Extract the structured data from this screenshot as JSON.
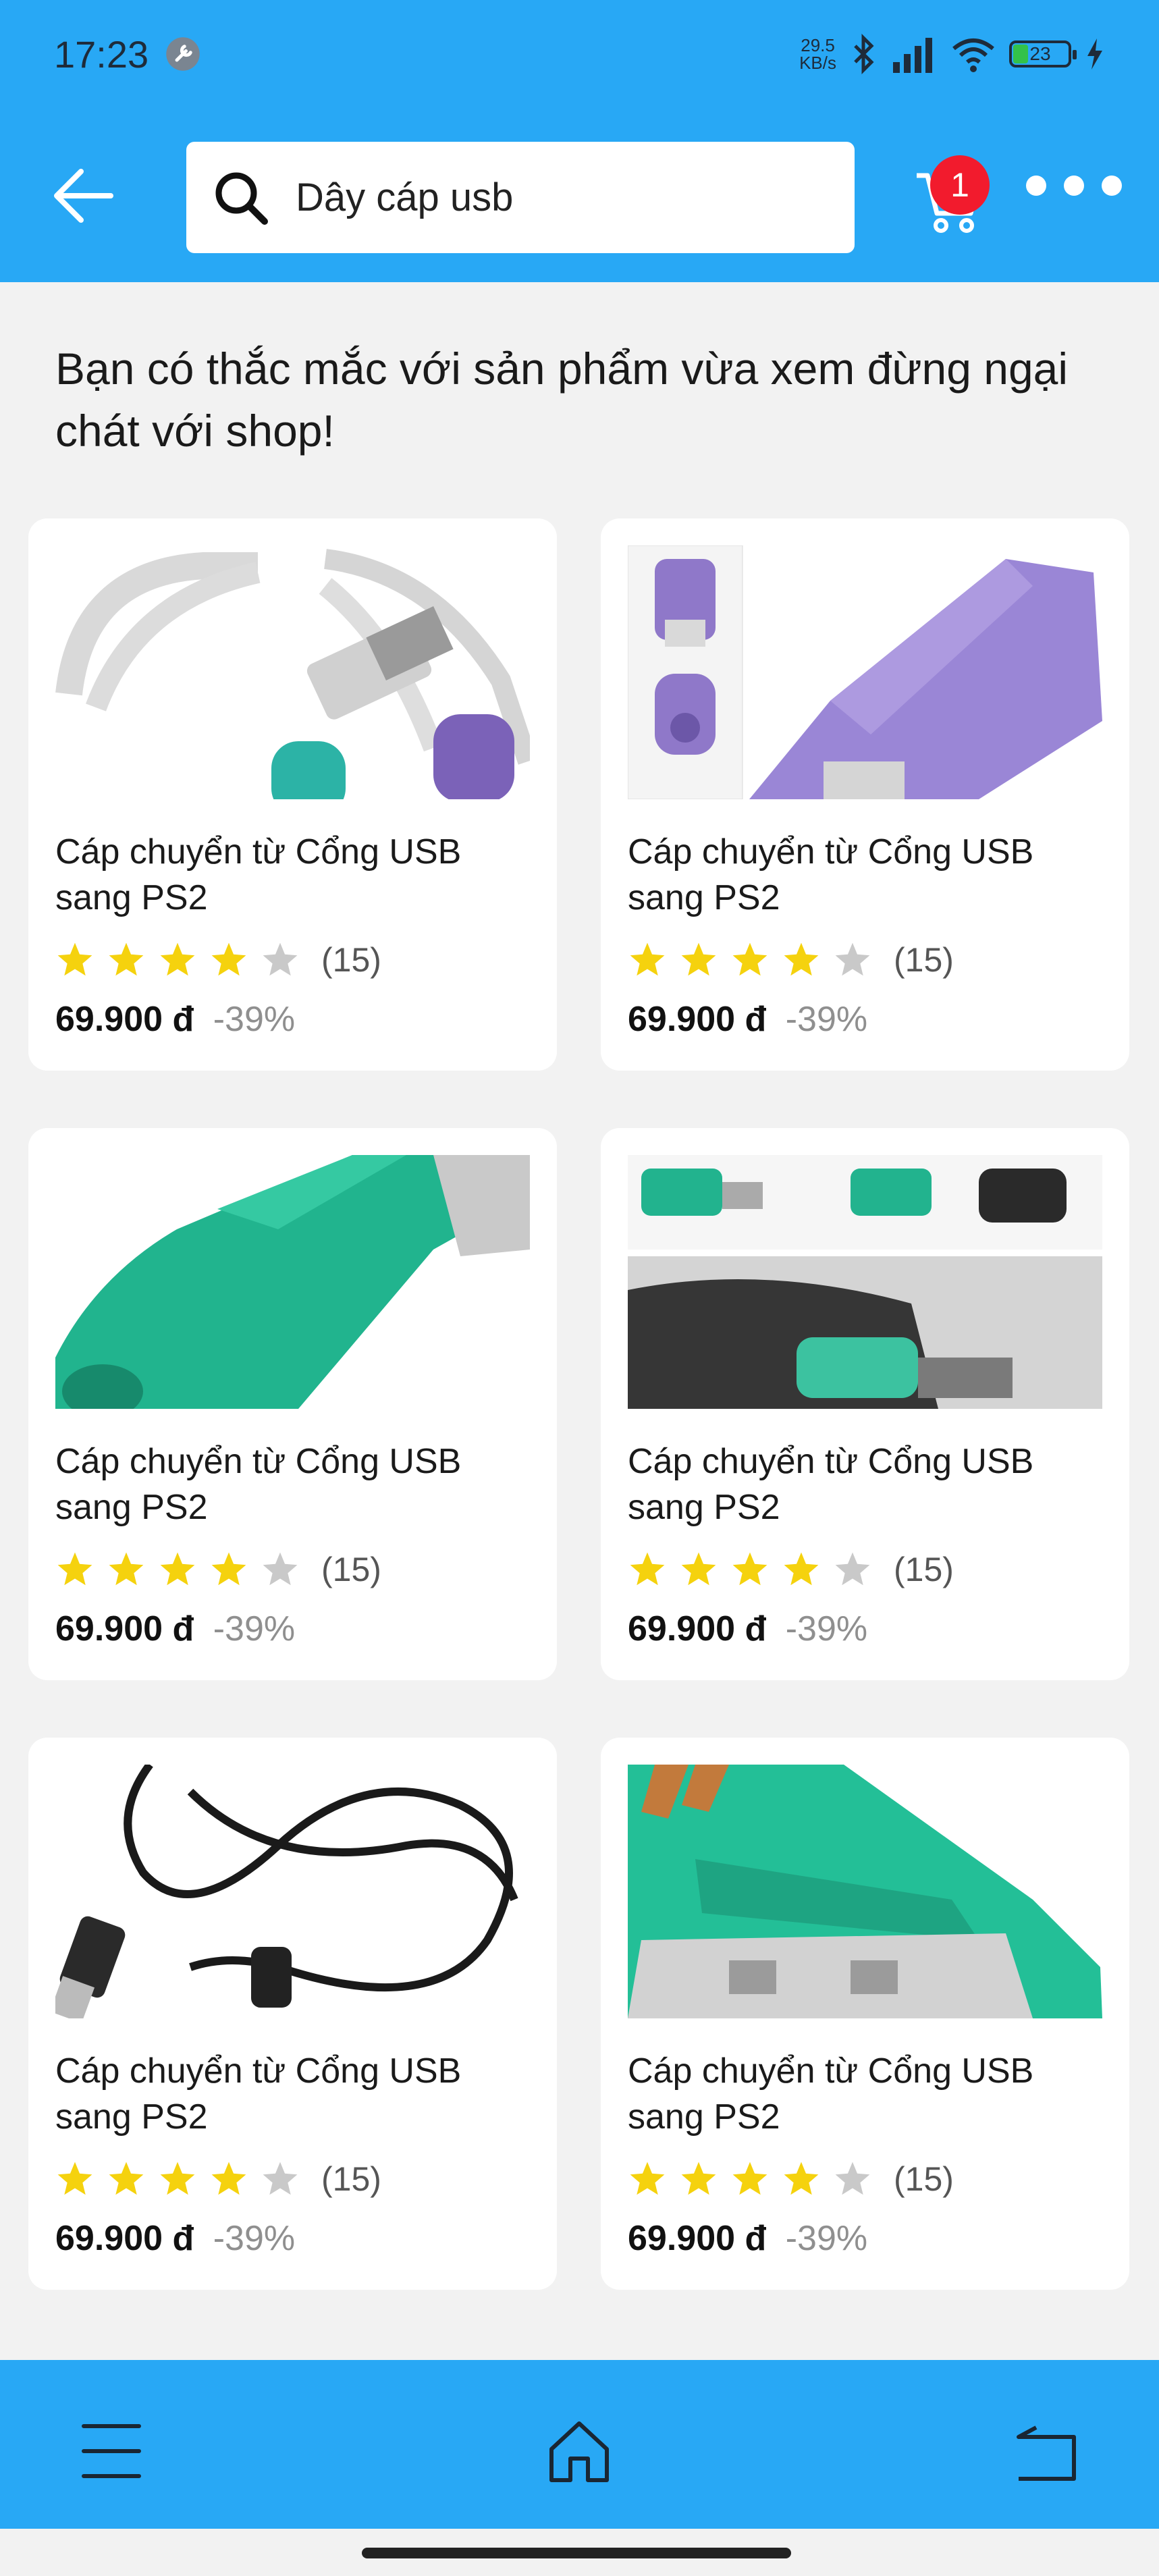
{
  "status": {
    "time": "17:23",
    "net_speed_value": "29.5",
    "net_speed_unit": "KB/s",
    "battery": "23"
  },
  "header": {
    "search_value": "Dây cáp usb",
    "cart_count": "1"
  },
  "notice": "Bạn có thắc mắc với sản phẩm vừa xem đừng ngại chát với shop!",
  "products": [
    {
      "title": "Cáp chuyển từ Cổng USB sang PS2",
      "rating": 4,
      "reviews": "(15)",
      "price": "69.900 đ",
      "discount": "-39%",
      "image": "usb-ps2-y-cable"
    },
    {
      "title": "Cáp chuyển từ Cổng USB sang PS2",
      "rating": 4,
      "reviews": "(15)",
      "price": "69.900 đ",
      "discount": "-39%",
      "image": "purple-adapter"
    },
    {
      "title": "Cáp chuyển từ Cổng USB sang PS2",
      "rating": 4,
      "reviews": "(15)",
      "price": "69.900 đ",
      "discount": "-39%",
      "image": "green-adapter"
    },
    {
      "title": "Cáp chuyển từ Cổng USB sang PS2",
      "rating": 4,
      "reviews": "(15)",
      "price": "69.900 đ",
      "discount": "-39%",
      "image": "adapters-in-pc"
    },
    {
      "title": "Cáp chuyển từ Cổng USB sang PS2",
      "rating": 4,
      "reviews": "(15)",
      "price": "69.900 đ",
      "discount": "-39%",
      "image": "black-usb-cable"
    },
    {
      "title": "Cáp chuyển từ Cổng USB sang PS2",
      "rating": 4,
      "reviews": "(15)",
      "price": "69.900 đ",
      "discount": "-39%",
      "image": "green-adapter-closeup"
    }
  ],
  "colors": {
    "accent": "#28a8f5",
    "star_filled": "#f5d20e",
    "star_empty": "#c9c9c9",
    "badge": "#f21b2d"
  },
  "icons": {
    "back": "arrow-left-icon",
    "search": "search-icon",
    "cart": "cart-icon",
    "more": "more-dots-icon",
    "menu": "menu-icon",
    "home": "home-icon",
    "return": "back-nav-icon"
  }
}
